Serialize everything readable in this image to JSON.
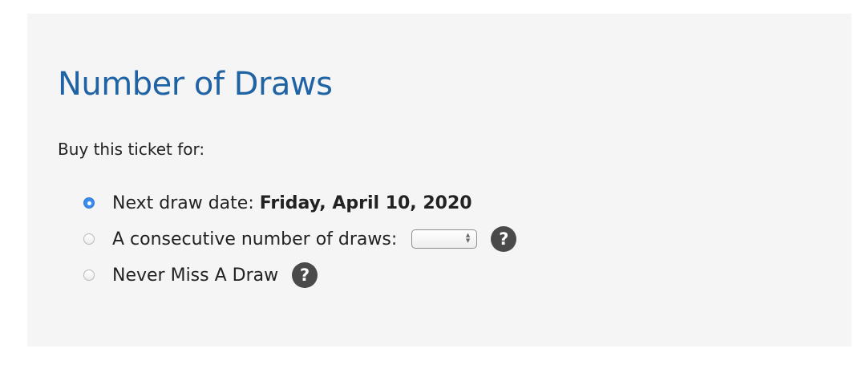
{
  "section": {
    "title": "Number of Draws",
    "intro": "Buy this ticket for:"
  },
  "options": [
    {
      "label": "Next draw date:",
      "date": "Friday, April 10, 2020",
      "selected": true
    },
    {
      "label": "A consecutive number of draws:",
      "select_value": "",
      "selected": false,
      "help_icon": "?"
    },
    {
      "label": "Never Miss A Draw",
      "selected": false,
      "help_icon": "?"
    }
  ],
  "colors": {
    "panel_background": "#f5f5f5",
    "title": "#1f63a4",
    "radio_selected": "#3b8bed",
    "help_icon_background": "#4a4a4a"
  }
}
